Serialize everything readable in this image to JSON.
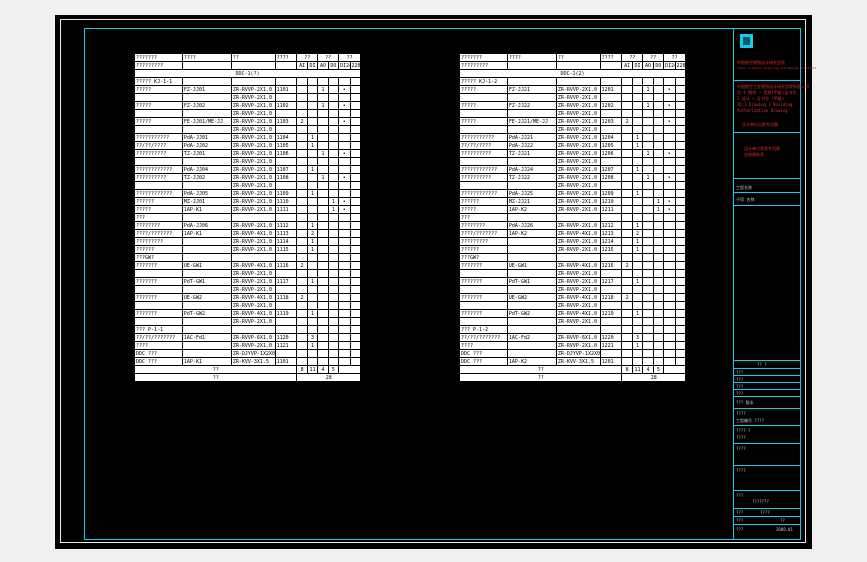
{
  "left_table": {
    "header_labels": [
      "???????",
      "????",
      "??",
      "????",
      "??",
      "??",
      "??"
    ],
    "subheader_labels": [
      "?????????",
      "AI",
      "DI",
      "AO",
      "DO",
      "DI24V",
      "220V"
    ],
    "section_title": "DDC-1(?)",
    "rows": [
      [
        "????? KJ-1-1",
        "",
        "",
        "",
        "",
        "",
        "",
        "",
        "",
        ""
      ],
      [
        "?????",
        "FZ-JJ01",
        "ZR-RVVP-2X1.0",
        "1101",
        "",
        "",
        "1",
        "",
        "•",
        ""
      ],
      [
        "",
        "",
        "ZR-RVVP-2X1.0",
        "",
        "",
        "",
        "",
        "",
        "",
        ""
      ],
      [
        "?????",
        "FZ-JJ02",
        "ZR-RVVP-2X1.0",
        "1102",
        "",
        "",
        "1",
        "",
        "•",
        ""
      ],
      [
        "",
        "",
        "ZR-RVVP-2X1.0",
        "",
        "",
        "",
        "",
        "",
        "",
        ""
      ],
      [
        "?????",
        "FE-JJ01/ME-JJ",
        "ZR-RVVP-2X1.0",
        "1103",
        "2",
        "",
        "",
        "",
        "•",
        ""
      ],
      [
        "",
        "",
        "ZR-RVVP-2X1.0",
        "",
        "",
        "",
        "",
        "",
        "",
        ""
      ],
      [
        "???????????",
        "PdA-JJ01",
        "ZR-RVVP-2X1.0",
        "1104",
        "",
        "1",
        "",
        "",
        "",
        ""
      ],
      [
        "??/??/????",
        "PdA-JJ02",
        "ZR-RVVP-2X1.0",
        "1105",
        "",
        "1",
        "",
        "",
        "",
        ""
      ],
      [
        "??????????",
        "TZ-JJ01",
        "ZR-RVVP-2X1.0",
        "1106",
        "",
        "",
        "1",
        "",
        "•",
        ""
      ],
      [
        "",
        "",
        "ZR-RVVP-2X1.0",
        "",
        "",
        "",
        "",
        "",
        "",
        ""
      ],
      [
        "????????????",
        "PdA-JJ04",
        "ZR-RVVP-2X1.0",
        "1107",
        "",
        "1",
        "",
        "",
        "",
        ""
      ],
      [
        "??????????",
        "TZ-JJ02",
        "ZR-RVVP-2X1.0",
        "1108",
        "",
        "",
        "1",
        "",
        "•",
        ""
      ],
      [
        "",
        "",
        "ZR-RVVP-2X1.0",
        "",
        "",
        "",
        "",
        "",
        "",
        ""
      ],
      [
        "????????????",
        "PdA-JJ05",
        "ZR-RVVP-2X1.0",
        "1109",
        "",
        "1",
        "",
        "",
        "",
        ""
      ],
      [
        "??????",
        "MZ-JJ01",
        "ZR-RVVP-2X1.0",
        "1110",
        "",
        "",
        "",
        "1",
        "•",
        ""
      ],
      [
        "?????",
        "1AP-K1",
        "ZR-RVVP-2X1.0",
        "1111",
        "",
        "",
        "",
        "1",
        "•",
        ""
      ],
      [
        "???",
        "",
        "",
        "",
        "",
        "",
        "",
        "",
        "",
        ""
      ],
      [
        "????????",
        "PdA-JJ06",
        "ZR-RVVP-2X1.0",
        "1112",
        "",
        "1",
        "",
        "",
        "",
        ""
      ],
      [
        "????/???????",
        "1AP-K1",
        "ZR-RVVP-4X1.0",
        "1113",
        "",
        "2",
        "",
        "",
        "",
        ""
      ],
      [
        "?????????",
        "",
        "ZR-RVVP-2X1.0",
        "1114",
        "",
        "1",
        "",
        "",
        "",
        ""
      ],
      [
        "??????",
        "",
        "ZR-RVVP-2X1.0",
        "1115",
        "",
        "1",
        "",
        "",
        "",
        ""
      ],
      [
        "???GW?",
        "",
        "",
        "",
        "",
        "",
        "",
        "",
        "",
        ""
      ],
      [
        "???????",
        "UE-GW1",
        "ZR-RVVP-4X1.0",
        "1116",
        "2",
        "",
        "",
        "",
        "",
        ""
      ],
      [
        "",
        "",
        "ZR-RVVP-2X1.0",
        "",
        "",
        "",
        "",
        "",
        "",
        ""
      ],
      [
        "???????",
        "PdT-GW1",
        "ZR-RVVP-2X1.0",
        "1117",
        "",
        "1",
        "",
        "",
        "",
        ""
      ],
      [
        "",
        "",
        "ZR-RVVP-2X1.0",
        "",
        "",
        "",
        "",
        "",
        "",
        ""
      ],
      [
        "???????",
        "UE-GW2",
        "ZR-RVVP-4X1.0",
        "1118",
        "2",
        "",
        "",
        "",
        "",
        ""
      ],
      [
        "",
        "",
        "ZR-RVVP-2X1.0",
        "",
        "",
        "",
        "",
        "",
        "",
        ""
      ],
      [
        "???????",
        "PdT-GW2",
        "ZR-RVVP-4X1.0",
        "1119",
        "",
        "1",
        "",
        "",
        "",
        ""
      ],
      [
        "",
        "",
        "ZR-RVVP-2X1.0",
        "",
        "",
        "",
        "",
        "",
        "",
        ""
      ],
      [
        "??? P-1-1",
        "",
        "",
        "",
        "",
        "",
        "",
        "",
        "",
        ""
      ],
      [
        "??/??/???????",
        "1AC-Fd1",
        "ZR-RVVP-6X1.0",
        "1120",
        "",
        "3",
        "",
        "",
        "",
        ""
      ],
      [
        "????",
        "",
        "ZR-RVVP-2X1.0",
        "1121",
        "",
        "1",
        "",
        "",
        "",
        ""
      ],
      [
        "DDC ???",
        "",
        "ZR-DJYVP-1X2X0",
        "",
        "",
        "",
        "",
        "",
        "",
        ""
      ],
      [
        "DDC ???",
        "1AP-K1",
        "ZR-KVV-3X1.5",
        "1101",
        "",
        "",
        "",
        "",
        "",
        ""
      ]
    ],
    "sum_row": [
      "??",
      "8",
      "11",
      "4",
      "5",
      ""
    ],
    "total_row": [
      "??",
      "28"
    ]
  },
  "right_table": {
    "header_labels": [
      "???????",
      "????",
      "??",
      "????",
      "??",
      "??",
      "??"
    ],
    "subheader_labels": [
      "?????????",
      "AI",
      "DI",
      "AO",
      "DO",
      "DI24V",
      "220V"
    ],
    "section_title": "DDC-1(2)",
    "rows": [
      [
        "????? KJ-1-2",
        "",
        "",
        "",
        "",
        "",
        "",
        "",
        "",
        ""
      ],
      [
        "?????",
        "FZ-JJ21",
        "ZR-RVVP-2X1.0",
        "1201",
        "",
        "",
        "1",
        "",
        "•",
        ""
      ],
      [
        "",
        "",
        "ZR-RVVP-2X1.0",
        "",
        "",
        "",
        "",
        "",
        "",
        ""
      ],
      [
        "?????",
        "FZ-JJ22",
        "ZR-RVVP-2X1.0",
        "1202",
        "",
        "",
        "1",
        "",
        "•",
        ""
      ],
      [
        "",
        "",
        "ZR-RVVP-2X1.0",
        "",
        "",
        "",
        "",
        "",
        "",
        ""
      ],
      [
        "?????",
        "FE-JJ21/ME-JJ",
        "ZR-RVVP-2X1.0",
        "1203",
        "2",
        "",
        "",
        "",
        "•",
        ""
      ],
      [
        "",
        "",
        "ZR-RVVP-2X1.0",
        "",
        "",
        "",
        "",
        "",
        "",
        ""
      ],
      [
        "???????????",
        "PdA-JJ21",
        "ZR-RVVP-2X1.0",
        "1204",
        "",
        "1",
        "",
        "",
        "",
        ""
      ],
      [
        "??/??/????",
        "PdA-JJ22",
        "ZR-RVVP-2X1.0",
        "1205",
        "",
        "1",
        "",
        "",
        "",
        ""
      ],
      [
        "??????????",
        "TZ-JJ21",
        "ZR-RVVP-2X1.0",
        "1206",
        "",
        "",
        "1",
        "",
        "•",
        ""
      ],
      [
        "",
        "",
        "ZR-RVVP-2X1.0",
        "",
        "",
        "",
        "",
        "",
        "",
        ""
      ],
      [
        "????????????",
        "PdA-JJ24",
        "ZR-RVVP-2X1.0",
        "1207",
        "",
        "1",
        "",
        "",
        "",
        ""
      ],
      [
        "??????????",
        "TZ-JJ22",
        "ZR-RVVP-2X1.0",
        "1208",
        "",
        "",
        "1",
        "",
        "•",
        ""
      ],
      [
        "",
        "",
        "ZR-RVVP-2X1.0",
        "",
        "",
        "",
        "",
        "",
        "",
        ""
      ],
      [
        "????????????",
        "PdA-JJ25",
        "ZR-RVVP-2X1.0",
        "1209",
        "",
        "1",
        "",
        "",
        "",
        ""
      ],
      [
        "??????",
        "MZ-JJ21",
        "ZR-RVVP-2X1.0",
        "1210",
        "",
        "",
        "",
        "1",
        "•",
        ""
      ],
      [
        "?????",
        "1AP-K2",
        "ZR-RVVP-2X1.0",
        "1211",
        "",
        "",
        "",
        "1",
        "•",
        ""
      ],
      [
        "???",
        "",
        "",
        "",
        "",
        "",
        "",
        "",
        "",
        ""
      ],
      [
        "????????",
        "PdA-JJ26",
        "ZR-RVVP-2X1.0",
        "1212",
        "",
        "1",
        "",
        "",
        "",
        ""
      ],
      [
        "????/???????",
        "1AP-K2",
        "ZR-RVVP-4X1.0",
        "1213",
        "",
        "2",
        "",
        "",
        "",
        ""
      ],
      [
        "?????????",
        "",
        "ZR-RVVP-2X1.0",
        "1214",
        "",
        "1",
        "",
        "",
        "",
        ""
      ],
      [
        "??????",
        "",
        "ZR-RVVP-2X1.0",
        "1215",
        "",
        "1",
        "",
        "",
        "",
        ""
      ],
      [
        "???GW?",
        "",
        "",
        "",
        "",
        "",
        "",
        "",
        "",
        ""
      ],
      [
        "???????",
        "UE-GW1",
        "ZR-RVVP-4X1.0",
        "1216",
        "2",
        "",
        "",
        "",
        "",
        ""
      ],
      [
        "",
        "",
        "ZR-RVVP-2X1.0",
        "",
        "",
        "",
        "",
        "",
        "",
        ""
      ],
      [
        "???????",
        "PdT-GW1",
        "ZR-RVVP-2X1.0",
        "1217",
        "",
        "1",
        "",
        "",
        "",
        ""
      ],
      [
        "",
        "",
        "ZR-RVVP-2X1.0",
        "",
        "",
        "",
        "",
        "",
        "",
        ""
      ],
      [
        "???????",
        "UE-GW2",
        "ZR-RVVP-4X1.0",
        "1218",
        "2",
        "",
        "",
        "",
        "",
        ""
      ],
      [
        "",
        "",
        "ZR-RVVP-2X1.0",
        "",
        "",
        "",
        "",
        "",
        "",
        ""
      ],
      [
        "???????",
        "PdT-GW2",
        "ZR-RVVP-4X1.0",
        "1219",
        "",
        "1",
        "",
        "",
        "",
        ""
      ],
      [
        "",
        "",
        "ZR-RVVP-2X1.0",
        "",
        "",
        "",
        "",
        "",
        "",
        ""
      ],
      [
        "??? P-1-2",
        "",
        "",
        "",
        "",
        "",
        "",
        "",
        "",
        ""
      ],
      [
        "??/??/???????",
        "1AC-Fd2",
        "ZR-RVVP-6X1.0",
        "1220",
        "",
        "3",
        "",
        "",
        "",
        ""
      ],
      [
        "????",
        "",
        "ZR-RVVP-2X1.0",
        "1221",
        "",
        "1",
        "",
        "",
        "",
        ""
      ],
      [
        "DDC ???",
        "",
        "ZR-DJYVP-1X2X0",
        "",
        "",
        "",
        "",
        "",
        "",
        ""
      ],
      [
        "DDC ???",
        "1AP-K2",
        "ZR-KVV-3X1.5",
        "1201",
        "",
        "",
        "",
        "",
        "",
        ""
      ]
    ],
    "sum_row": [
      "??",
      "8",
      "11",
      "4",
      "5",
      ""
    ],
    "total_row": [
      "??",
      "28"
    ]
  },
  "title_block": {
    "company": "中国航空规划设计研究总院",
    "company_en": "China Aviation Planning and Design Institute",
    "red_lines": [
      "中国航空工业规划设计研究总院有限公司",
      "注:1 图纸 ~ 资质(甲级)证书号",
      "2 设计 ~ 证书号 (甲级)",
      "ID:1 Drawing 1 Building",
      "Authorization Drawing",
      "设计单位出图专用章"
    ],
    "stamp_1": "设计单位出图专用章",
    "stamp_2": "设计单位资质专用章",
    "stamp_2_sub": "注册建筑师",
    "field_rows": [
      "工程名称",
      "子项 名称"
    ],
    "notes_label": "?? ?",
    "small_rows": [
      "???",
      "???",
      "???",
      "???",
      "???",
      "???"
    ],
    "version": "??? 版本",
    "lower_rows": [
      "????",
      "工程编号 ????",
      "???? ?",
      "????",
      "????",
      "????"
    ],
    "sheet_name": "???????",
    "bottom_rows": [
      "???",
      "???",
      "???",
      "???"
    ],
    "sheet_no": "????",
    "date": "2009.01",
    "page": "??"
  },
  "colors": {
    "frame_cyan": "#19c9e8",
    "frame_white": "#e8e8e8",
    "background": "#000000",
    "stamp_red": "#e03030"
  }
}
